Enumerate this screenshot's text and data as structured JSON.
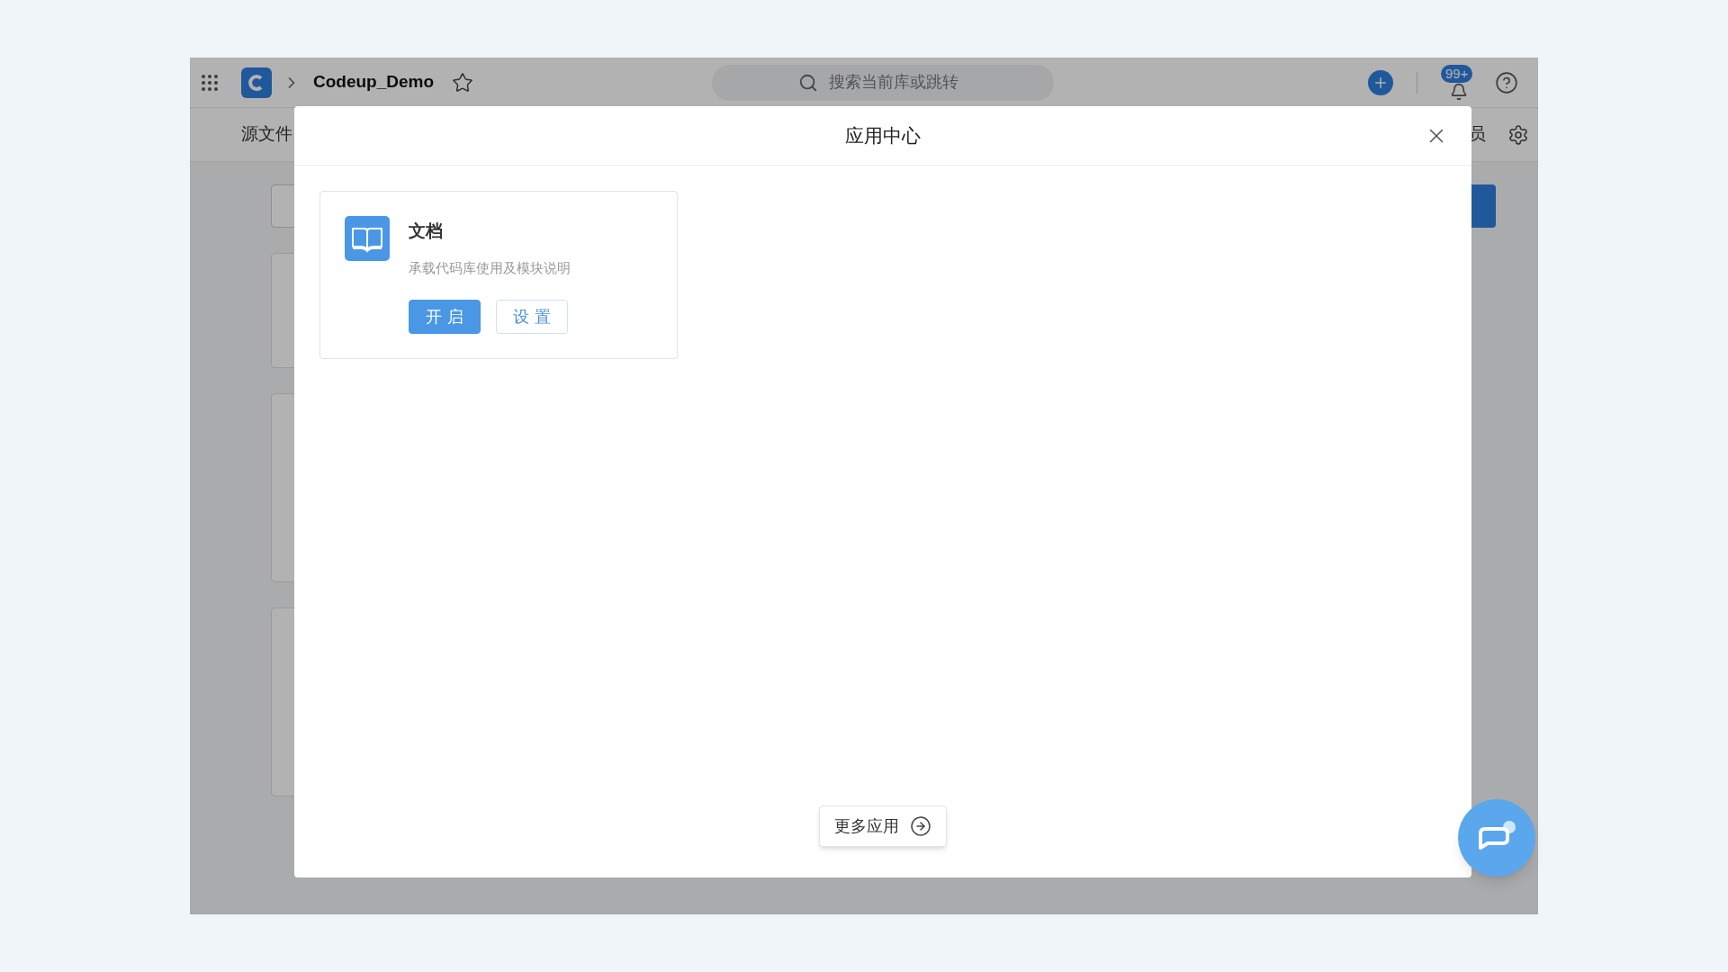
{
  "top_bar": {
    "repo_name": "Codeup_Demo",
    "search": {
      "placeholder": "搜索当前库或跳转"
    },
    "notification_badge": "99+"
  },
  "tabs": [
    {
      "label": "源文件"
    },
    {
      "label": "员"
    }
  ],
  "modal": {
    "title": "应用中心",
    "apps": [
      {
        "title": "文档",
        "description": "承载代码库使用及模块说明",
        "buttons": [
          {
            "label": "开启",
            "kind": "primary"
          },
          {
            "label": "设置",
            "kind": "default"
          }
        ]
      }
    ],
    "more_button": "更多应用"
  }
}
